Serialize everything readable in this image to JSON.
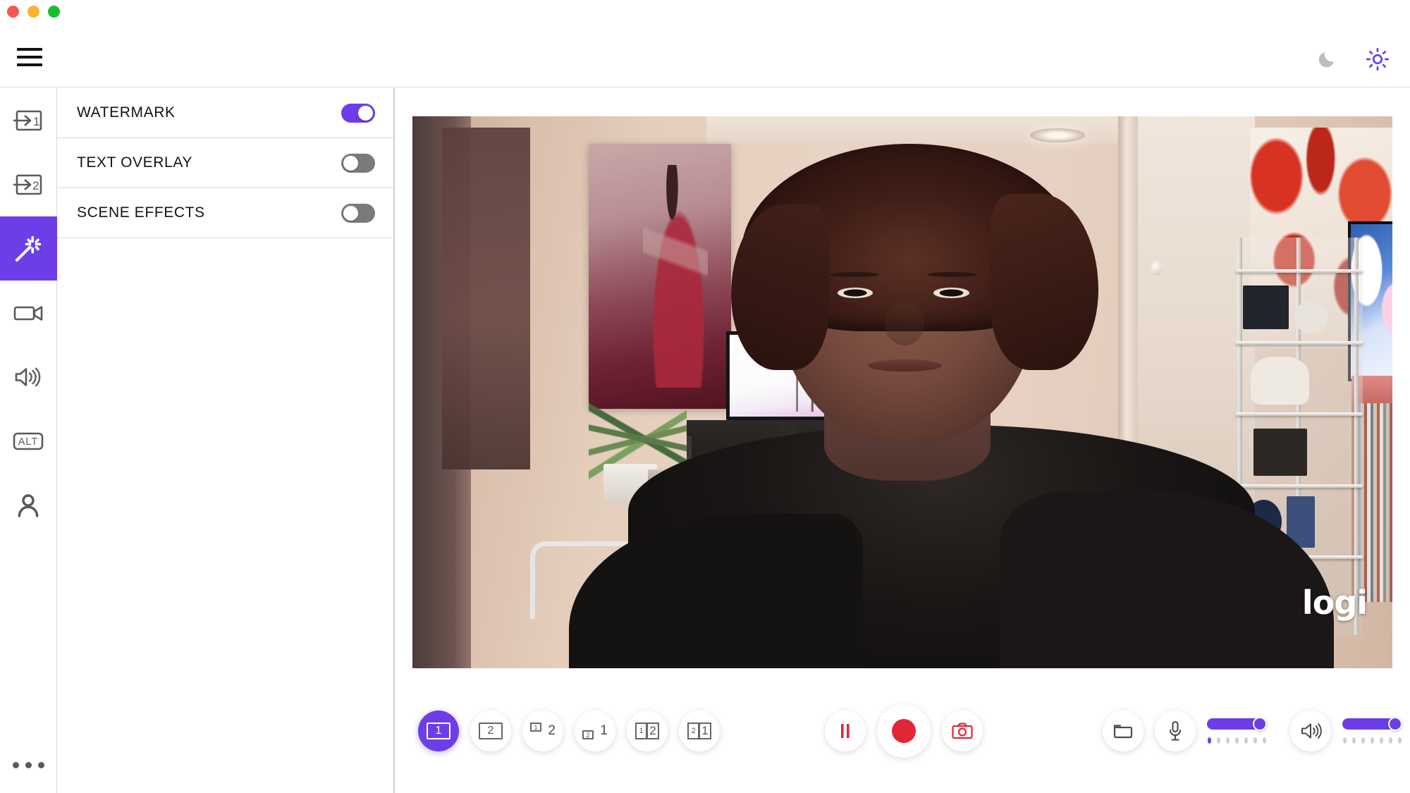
{
  "window": {
    "traffic_lights": [
      {
        "name": "close",
        "color": "#F4594F"
      },
      {
        "name": "minimize",
        "color": "#F9B32F"
      },
      {
        "name": "maximize",
        "color": "#18BE2D"
      }
    ]
  },
  "topbar": {
    "menu_icon": "hamburger-icon",
    "theme": {
      "dark_icon": "moon-icon",
      "dark_color": "#b8b8b8",
      "light_icon": "sun-icon",
      "light_color": "#6C3EE8",
      "active": "light"
    }
  },
  "sidebar": {
    "accent": "#6C3EE8",
    "items": [
      {
        "icon": "input-source-1-icon",
        "label": "1",
        "active": false
      },
      {
        "icon": "input-source-2-icon",
        "label": "2",
        "active": false
      },
      {
        "icon": "magic-wand-icon",
        "label": "",
        "active": true
      },
      {
        "icon": "camera-icon",
        "label": "",
        "active": false
      },
      {
        "icon": "speaker-icon",
        "label": "",
        "active": false
      },
      {
        "icon": "alt-icon",
        "label": "ALT",
        "active": false
      },
      {
        "icon": "person-icon",
        "label": "",
        "active": false
      }
    ],
    "more_icon": "more-options-icon"
  },
  "panel": {
    "rows": [
      {
        "label": "WATERMARK",
        "on": true
      },
      {
        "label": "TEXT OVERLAY",
        "on": false
      },
      {
        "label": "SCENE EFFECTS",
        "on": false
      }
    ]
  },
  "video": {
    "watermark_text": "logi",
    "subject_alt": "woman-webcam-preview"
  },
  "controls": {
    "layouts": [
      {
        "name": "layout-single-1",
        "type": "single",
        "main": "1",
        "active": true
      },
      {
        "name": "layout-single-2",
        "type": "single",
        "main": "2",
        "active": false
      },
      {
        "name": "layout-pip-1-over-2",
        "type": "pip",
        "pip": "1",
        "main": "2",
        "active": false
      },
      {
        "name": "layout-pip-2-over-1",
        "type": "pip",
        "pip": "2",
        "main": "1",
        "active": false
      },
      {
        "name": "layout-split-1-2",
        "type": "split",
        "left": "1",
        "right": "2",
        "emphasis": "right",
        "active": false
      },
      {
        "name": "layout-split-2-1",
        "type": "split",
        "left": "2",
        "right": "1",
        "emphasis": "right",
        "active": false
      }
    ],
    "transport": [
      {
        "name": "pause-button",
        "icon": "pause-icon",
        "color": "#E32636",
        "big": false
      },
      {
        "name": "record-button",
        "icon": "record-icon",
        "color": "#E32636",
        "big": true
      },
      {
        "name": "snapshot-button",
        "icon": "camera-icon",
        "color": "#E32636",
        "big": false
      }
    ],
    "right": {
      "folder": {
        "name": "open-folder-button",
        "icon": "folder-icon"
      },
      "mic": {
        "name": "microphone-button",
        "icon": "microphone-icon",
        "slider_value": 100,
        "accent": "#6C3EE8",
        "level_dots": 7,
        "level_lit": 1
      },
      "speaker": {
        "name": "speaker-button",
        "icon": "speaker-icon",
        "slider_value": 100,
        "accent": "#6C3EE8",
        "level_dots": 7,
        "level_lit": 0
      }
    }
  }
}
